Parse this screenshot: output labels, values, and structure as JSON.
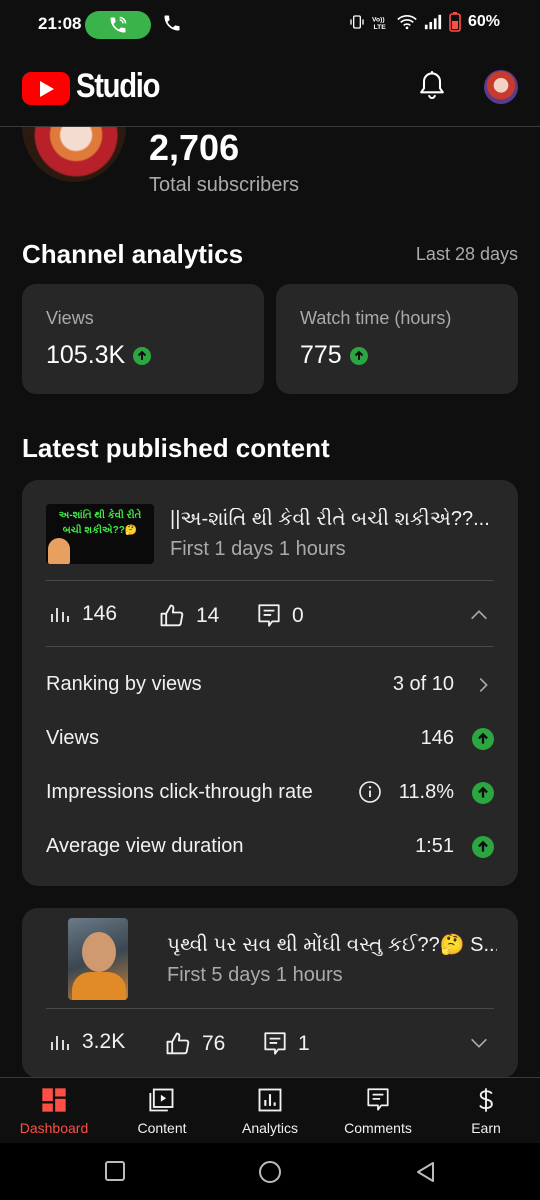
{
  "status_bar": {
    "time": "21:08",
    "battery": "60%"
  },
  "app_bar": {
    "logo_text": "Studio"
  },
  "channel": {
    "subscriber_count": "2,706",
    "subscriber_label": "Total subscribers"
  },
  "analytics": {
    "heading": "Channel analytics",
    "period": "Last 28 days",
    "cards": [
      {
        "label": "Views",
        "value": "105.3K"
      },
      {
        "label": "Watch time (hours)",
        "value": "775"
      }
    ]
  },
  "latest": {
    "heading": "Latest published content",
    "items": [
      {
        "title": "||અ-શાંતિ થી કેવી રીતે બચી શકીએ??...",
        "thumb_text": "અ-શાંતિ થી કેવી રીતે બચી શકીએ??🤔",
        "subtitle": "First 1 days 1 hours",
        "views": "146",
        "likes": "14",
        "comments": "0",
        "details": [
          {
            "label": "Ranking by views",
            "value": "3 of 10"
          },
          {
            "label": "Views",
            "value": "146"
          },
          {
            "label": "Impressions click-through rate",
            "value": "11.8%"
          },
          {
            "label": "Average view duration",
            "value": "1:51"
          }
        ]
      },
      {
        "title": "પૃથ્વી પર સવ થી મોંઘી વસ્તુ કઈ??🤔 S...",
        "subtitle": "First 5 days 1 hours",
        "views": "3.2K",
        "likes": "76",
        "comments": "1"
      }
    ]
  },
  "bottom_nav": {
    "items": [
      {
        "label": "Dashboard",
        "icon": "dashboard-icon",
        "active": true
      },
      {
        "label": "Content",
        "icon": "content-icon"
      },
      {
        "label": "Analytics",
        "icon": "analytics-icon"
      },
      {
        "label": "Comments",
        "icon": "comments-icon"
      },
      {
        "label": "Earn",
        "icon": "earn-icon"
      }
    ]
  },
  "colors": {
    "accent": "#ff0000",
    "active_nav": "#ff4e45",
    "positive": "#2ba640",
    "card": "#272727",
    "background": "#0f0f0f"
  }
}
